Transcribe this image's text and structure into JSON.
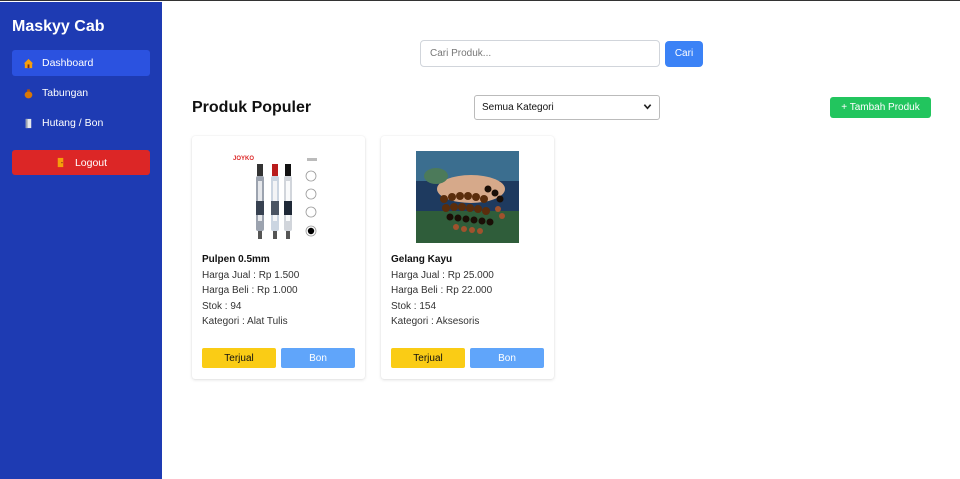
{
  "sidebar": {
    "brand": "Maskyy Cab",
    "items": [
      {
        "label": "Dashboard",
        "icon": "house-icon",
        "active": true
      },
      {
        "label": "Tabungan",
        "icon": "money-bag-icon",
        "active": false
      },
      {
        "label": "Hutang / Bon",
        "icon": "notebook-icon",
        "active": false
      }
    ],
    "logout_label": "Logout",
    "logout_icon": "door-icon"
  },
  "search": {
    "placeholder": "Cari Produk...",
    "button_label": "Cari"
  },
  "main": {
    "section_title": "Produk Populer",
    "category_selected": "Semua Kategori",
    "add_button_label": "+ Tambah Produk"
  },
  "products": [
    {
      "name": "Pulpen 0.5mm",
      "harga_jual": "Harga Jual : Rp 1.500",
      "harga_beli": "Harga Beli : Rp 1.000",
      "stok": "Stok : 94",
      "kategori": "Kategori : Alat Tulis",
      "image_text": "JOYKO",
      "sold_label": "Terjual",
      "bon_label": "Bon"
    },
    {
      "name": "Gelang Kayu",
      "harga_jual": "Harga Jual : Rp 25.000",
      "harga_beli": "Harga Beli : Rp 22.000",
      "stok": "Stok : 154",
      "kategori": "Kategori : Aksesoris",
      "sold_label": "Terjual",
      "bon_label": "Bon"
    }
  ],
  "colors": {
    "sidebar_bg": "#1e3bb3",
    "active_nav": "#2b52e0",
    "logout": "#dc2626",
    "search_button": "#3b82f6",
    "add_button": "#22c55e",
    "sold_button": "#facc15",
    "bon_button": "#60a5fa"
  }
}
